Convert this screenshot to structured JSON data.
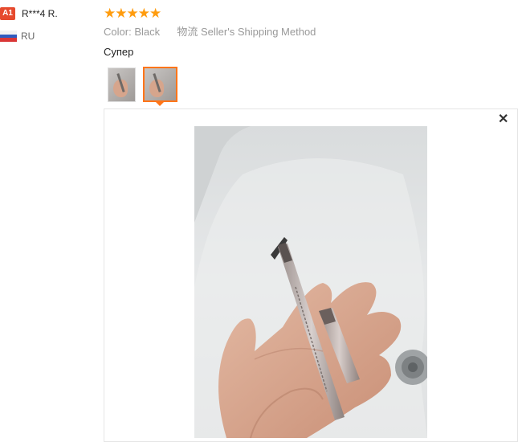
{
  "buyer": {
    "badge": "A1",
    "name": "R***4 R.",
    "country": "RU",
    "flag_icon": "russia-flag-icon"
  },
  "review": {
    "rating": 5,
    "stars": "★★★★★",
    "color_label": "Color:",
    "color_value": "Black",
    "shipping_label": "物流",
    "shipping_value": "Seller's Shipping Method",
    "text": "Супер"
  },
  "photos": {
    "count": 2,
    "selected_index": 1,
    "close_symbol": "✕"
  },
  "colors": {
    "accent": "#ff7519",
    "star": "#ff9c0e",
    "badge": "#e64a2e"
  }
}
